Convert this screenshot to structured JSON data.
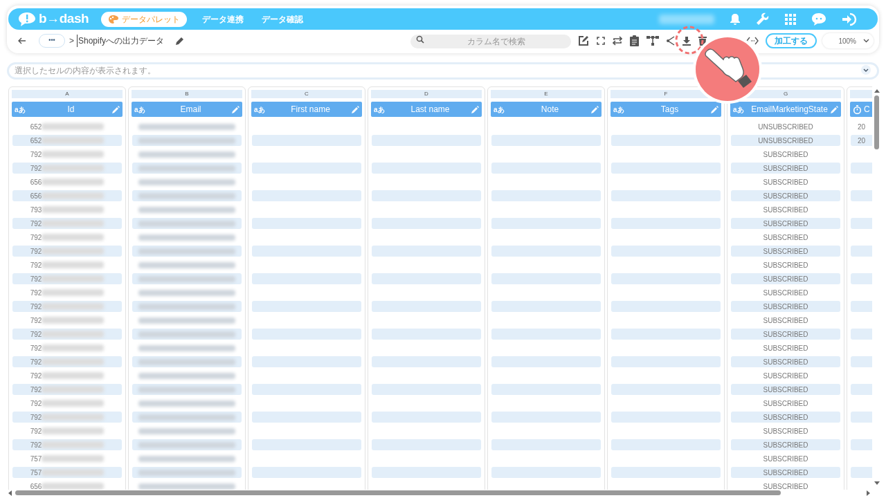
{
  "app": {
    "logo": "b→dash"
  },
  "nav": [
    {
      "label": "データパレット",
      "selected": true
    },
    {
      "label": "データ連携",
      "selected": false
    },
    {
      "label": "データ確認",
      "selected": false
    }
  ],
  "breadcrumb": {
    "more": "•••",
    "separator": ">",
    "title": "Shopifyへの出力データ"
  },
  "search": {
    "placeholder": "カラム名で検索"
  },
  "toolbar": {
    "action": "加工する",
    "zoom": "100%"
  },
  "formula_bar": {
    "placeholder": "選択したセルの内容が表示されます。"
  },
  "columns": [
    {
      "letter": "A",
      "name": "Id",
      "kind": "text",
      "type_label": "aあ"
    },
    {
      "letter": "B",
      "name": "Email",
      "kind": "text",
      "type_label": "aあ"
    },
    {
      "letter": "C",
      "name": "First name",
      "kind": "text",
      "type_label": "aあ"
    },
    {
      "letter": "D",
      "name": "Last name",
      "kind": "text",
      "type_label": "aあ"
    },
    {
      "letter": "E",
      "name": "Note",
      "kind": "text",
      "type_label": "aあ"
    },
    {
      "letter": "F",
      "name": "Tags",
      "kind": "text",
      "type_label": "aあ"
    },
    {
      "letter": "G",
      "name": "EmailMarketingState",
      "kind": "text",
      "type_label": "aあ"
    },
    {
      "name": "C",
      "kind": "time"
    }
  ],
  "rows": [
    {
      "id": "652",
      "state": "UNSUBSCRIBED",
      "column_h": "20"
    },
    {
      "id": "652",
      "state": "UNSUBSCRIBED",
      "column_h": "20"
    },
    {
      "id": "792",
      "state": "SUBSCRIBED"
    },
    {
      "id": "792",
      "state": "SUBSCRIBED"
    },
    {
      "id": "656",
      "state": "SUBSCRIBED"
    },
    {
      "id": "656",
      "state": "SUBSCRIBED"
    },
    {
      "id": "793",
      "state": "SUBSCRIBED"
    },
    {
      "id": "792",
      "state": "SUBSCRIBED"
    },
    {
      "id": "792",
      "state": "SUBSCRIBED"
    },
    {
      "id": "792",
      "state": "SUBSCRIBED"
    },
    {
      "id": "792",
      "state": "SUBSCRIBED"
    },
    {
      "id": "792",
      "state": "SUBSCRIBED"
    },
    {
      "id": "792",
      "state": "SUBSCRIBED"
    },
    {
      "id": "792",
      "state": "SUBSCRIBED"
    },
    {
      "id": "792",
      "state": "SUBSCRIBED"
    },
    {
      "id": "792",
      "state": "SUBSCRIBED"
    },
    {
      "id": "792",
      "state": "SUBSCRIBED"
    },
    {
      "id": "792",
      "state": "SUBSCRIBED"
    },
    {
      "id": "792",
      "state": "SUBSCRIBED"
    },
    {
      "id": "792",
      "state": "SUBSCRIBED"
    },
    {
      "id": "792",
      "state": "SUBSCRIBED"
    },
    {
      "id": "792",
      "state": "SUBSCRIBED"
    },
    {
      "id": "792",
      "state": "SUBSCRIBED"
    },
    {
      "id": "792",
      "state": "SUBSCRIBED"
    },
    {
      "id": "757",
      "state": "SUBSCRIBED"
    },
    {
      "id": "757",
      "state": "SUBSCRIBED"
    },
    {
      "id": "656",
      "state": "SUBSCRIBED"
    }
  ]
}
